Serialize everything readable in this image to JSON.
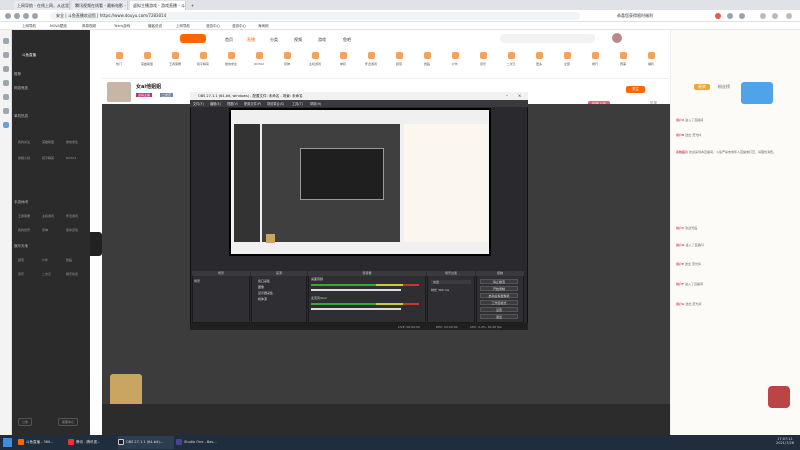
{
  "browser": {
    "tabs": [
      "上网导航 - 在线上网，从这里开始",
      "腾讯视频在线看 - 最新电影 - 大量在线",
      "虚拟主播游戏 - 游戏直播 - 斗鱼直播",
      "+"
    ],
    "url": "安全 | 斗鱼直播欢迎您 | https://www.douyu.com/7283014",
    "right_label": "恭喜您获得限时福利",
    "bookmarks": [
      "上网导航",
      "NOVA壁纸",
      "简易视频",
      "Tetris游戏",
      "播客说说",
      "上网导航",
      "漫游中心",
      "漫游中心",
      "海淘网"
    ]
  },
  "sidebar": {
    "logo_text": "斗鱼直播",
    "sections": [
      "推荐",
      "网游竞技",
      "单机热游",
      "手游休闲",
      "娱乐天地"
    ],
    "items_a": [
      "我的关注",
      "英雄联盟",
      "绝地求生",
      "穿越火线",
      "和平精英",
      "DOTA2"
    ],
    "items_b": [
      "王者荣耀",
      "主机游戏",
      "怀旧游戏",
      "我的世界",
      "原神",
      "使命召唤"
    ],
    "items_c": [
      "颜值",
      "户外",
      "舞蹈",
      "音乐",
      "二次元",
      "娱乐综合"
    ],
    "footer": [
      "公告",
      "客服中心"
    ]
  },
  "nav": {
    "items": [
      "首页",
      "直播",
      "分类",
      "视频",
      "游戏",
      "鱼吧"
    ]
  },
  "categories": [
    "热门",
    "英雄联盟",
    "王者荣耀",
    "和平精英",
    "绝地求生",
    "DOTA2",
    "原神",
    "主机游戏",
    "单机",
    "怀旧游戏",
    "颜值",
    "舞蹈",
    "户外",
    "音乐",
    "二次元",
    "更多",
    "全部",
    "排行",
    "赛事",
    "福利"
  ],
  "room": {
    "title": "女ai他姐姐",
    "tags": [
      "虚拟主播",
      "二次元"
    ],
    "follow": "关注",
    "report": "举报",
    "gift_badge": "玩转上热"
  },
  "right_panel": {
    "header": "贵宾",
    "rank_tabs": [
      "贵宾",
      "粉丝榜"
    ],
    "chat": [
      {
        "user": "系统提示",
        "msg": "欢迎来到本直播间，斗鱼严禁未成年人直播或打赏，请理性消费。"
      },
      {
        "user": "用户A",
        "msg": "进入了直播间"
      },
      {
        "user": "用户B",
        "msg": "送出 荧光棒"
      },
      {
        "user": "用户C",
        "msg": "欢迎光临"
      },
      {
        "user": "用户D",
        "msg": "进入了直播间"
      },
      {
        "user": "用户E",
        "msg": "送出 荧光棒"
      },
      {
        "user": "用户F",
        "msg": "进入了直播间"
      },
      {
        "user": "用户G",
        "msg": "送出 荧光棒"
      }
    ]
  },
  "obs": {
    "title": "OBS 27.1.1 (64-bit, windows) - 配置文件: 未命名 - 场景: 未命名",
    "menu": [
      "文件(F)",
      "编辑(E)",
      "视图(V)",
      "配置文件(P)",
      "场景集合(S)",
      "工具(T)",
      "帮助(H)"
    ],
    "docks": [
      "场景",
      "来源",
      "混音器",
      "场景过渡",
      "控制"
    ],
    "scene_name": "场景",
    "sources": [
      "窗口采集",
      "图像",
      "显示器采集",
      "媒体源"
    ],
    "mixer": [
      "桌面音频",
      "麦克风/Aux"
    ],
    "transition": [
      "淡出",
      "时长 300 ms"
    ],
    "controls": [
      "停止推流",
      "开始录制",
      "启动虚拟摄像机",
      "工作室模式",
      "设置",
      "退出"
    ],
    "status": [
      "LIVE: 00:00:00",
      "REC: 00:00:00",
      "CPU: 2.4%, 30.00 fps"
    ]
  },
  "taskbar": {
    "items": [
      "斗鱼直播 - 360...",
      "腾讯 - 腾讯视...",
      "OBS 27.1.1 (64-bit)...",
      "Studio One - Bas..."
    ],
    "time": "17:07:11",
    "date": "2021/7/26"
  }
}
